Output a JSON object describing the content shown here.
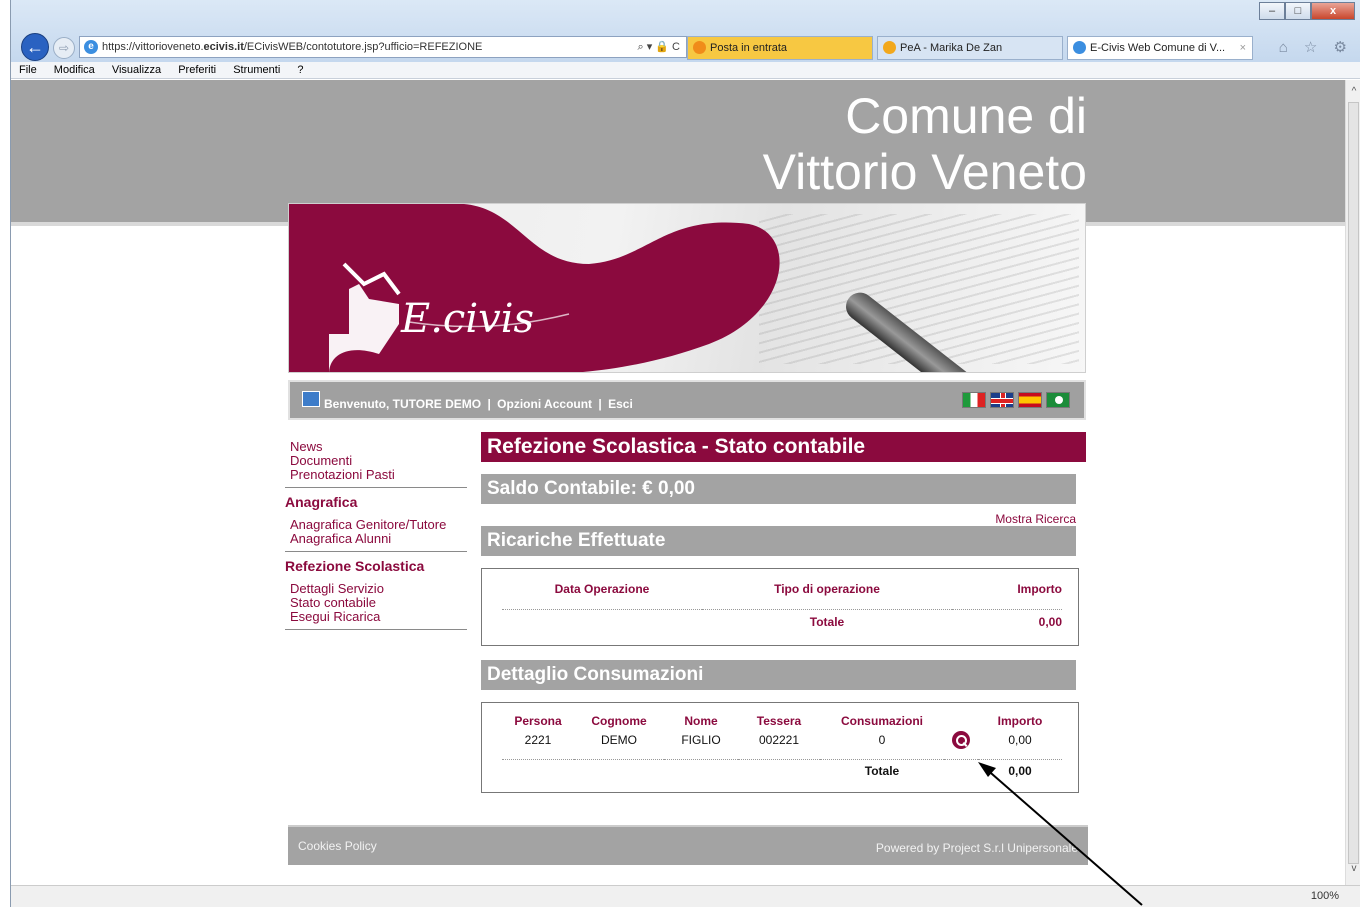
{
  "browser": {
    "url_prefix": "https://vittorioveneto.",
    "url_domain": "ecivis.it",
    "url_path": "/ECivisWEB/contotutore.jsp?ufficio=REFEZIONE",
    "address_tools": "⌕ ▾ 🔒 C",
    "tabs": [
      {
        "label": "Posta in entrata"
      },
      {
        "label": "PeA - Marika De Zan"
      },
      {
        "label": "E-Civis Web Comune di V...",
        "close": "×"
      }
    ],
    "menu": [
      "File",
      "Modifica",
      "Visualizza",
      "Preferiti",
      "Strumenti",
      "?"
    ],
    "zoom": "100%",
    "right_icons": "⌂ ☆ ⚙"
  },
  "header": {
    "line1": "Comune di",
    "line2": "Vittorio Veneto"
  },
  "banner": {
    "logo_text": "E.civis"
  },
  "welcome": {
    "greeting": "Benvenuto, TUTORE DEMO",
    "options": "Opzioni Account",
    "logout": "Esci",
    "sep": "|"
  },
  "sidebar": {
    "top_links": [
      "News",
      "Documenti",
      "Prenotazioni Pasti"
    ],
    "group1_title": "Anagrafica",
    "group1_links": [
      "Anagrafica Genitore/Tutore",
      "Anagrafica Alunni"
    ],
    "group2_title": "Refezione Scolastica",
    "group2_links": [
      "Dettagli Servizio",
      "Stato contabile",
      "Esegui Ricarica"
    ]
  },
  "main": {
    "title": "Refezione Scolastica - Stato contabile",
    "saldo": "Saldo Contabile: € 0,00",
    "mostra_ricerca": "Mostra Ricerca",
    "ricariche_title": "Ricariche Effettuate",
    "ricariche_cols": [
      "Data Operazione",
      "Tipo di operazione",
      "Importo"
    ],
    "ricariche_total_label": "Totale",
    "ricariche_total": "0,00",
    "dettaglio_title": "Dettaglio Consumazioni",
    "cons_cols": [
      "Persona",
      "Cognome",
      "Nome",
      "Tessera",
      "Consumazioni",
      "Importo"
    ],
    "cons_rows": [
      {
        "persona": "2221",
        "cognome": "DEMO",
        "nome": "FIGLIO",
        "tessera": "002221",
        "consumazioni": "0",
        "importo": "0,00"
      }
    ],
    "cons_total_label": "Totale",
    "cons_total": "0,00"
  },
  "footer": {
    "left": "Cookies Policy",
    "right": "Powered by Project S.r.l Unipersonale"
  },
  "colors": {
    "brand": "#8b0a3e",
    "grey": "#a3a3a3"
  }
}
